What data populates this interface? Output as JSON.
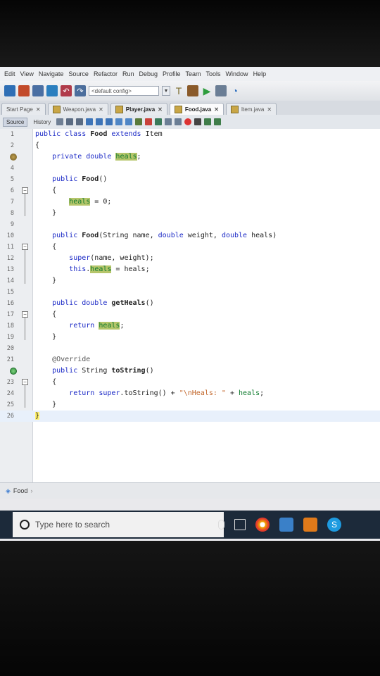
{
  "menu": [
    "Edit",
    "View",
    "Navigate",
    "Source",
    "Refactor",
    "Run",
    "Debug",
    "Profile",
    "Team",
    "Tools",
    "Window",
    "Help"
  ],
  "toolbar": {
    "config_value": "<default config>"
  },
  "tabs": [
    {
      "label": "Start Page",
      "active": false
    },
    {
      "label": "Weapon.java",
      "active": false
    },
    {
      "label": "Player.java",
      "active": false
    },
    {
      "label": "Food.java",
      "active": true
    },
    {
      "label": "Item.java",
      "active": false
    }
  ],
  "editor_modes": {
    "source": "Source",
    "history": "History"
  },
  "code_lines": [
    {
      "n": "1",
      "text": "public class Food extends Item"
    },
    {
      "n": "2",
      "text": "{"
    },
    {
      "n": "",
      "text": "    private double heals;"
    },
    {
      "n": "4",
      "text": ""
    },
    {
      "n": "5",
      "text": "    public Food()"
    },
    {
      "n": "6",
      "text": "    {"
    },
    {
      "n": "7",
      "text": "        heals = 0;"
    },
    {
      "n": "8",
      "text": "    }"
    },
    {
      "n": "9",
      "text": ""
    },
    {
      "n": "10",
      "text": "    public Food(String name, double weight, double heals)"
    },
    {
      "n": "11",
      "text": "    {"
    },
    {
      "n": "12",
      "text": "        super(name, weight);"
    },
    {
      "n": "13",
      "text": "        this.heals = heals;"
    },
    {
      "n": "14",
      "text": "    }"
    },
    {
      "n": "15",
      "text": ""
    },
    {
      "n": "16",
      "text": "    public double getHeals()"
    },
    {
      "n": "17",
      "text": "    {"
    },
    {
      "n": "18",
      "text": "        return heals;"
    },
    {
      "n": "19",
      "text": "    }"
    },
    {
      "n": "20",
      "text": ""
    },
    {
      "n": "21",
      "text": "    @Override"
    },
    {
      "n": "",
      "text": "    public String toString()"
    },
    {
      "n": "23",
      "text": "    {"
    },
    {
      "n": "24",
      "text": "        return super.toString() + \"\\nHeals: \" + heals;"
    },
    {
      "n": "25",
      "text": "    }"
    },
    {
      "n": "26",
      "text": "}"
    }
  ],
  "breadcrumb": {
    "item": "Food"
  },
  "taskbar": {
    "search_placeholder": "Type here to search"
  },
  "colors": {
    "keyword": "#1b29c6",
    "field": "#0e7a2d",
    "field_highlight": "#b5c56a",
    "string": "#c2672b"
  }
}
